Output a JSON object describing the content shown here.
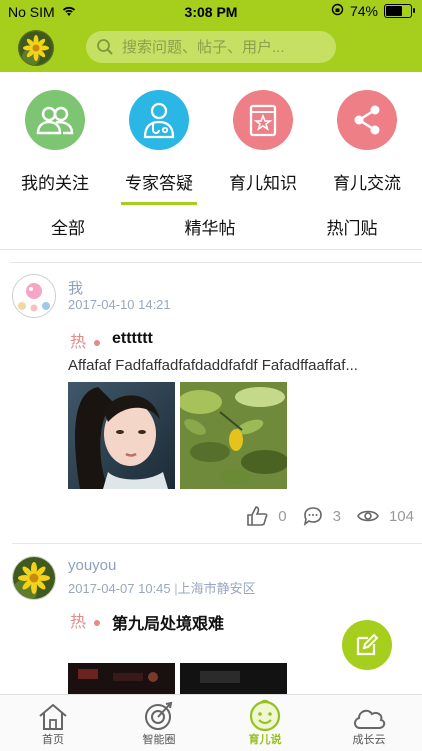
{
  "status_bar": {
    "carrier": "No SIM",
    "time": "3:08 PM",
    "battery": "74%",
    "battery_level": 0.74
  },
  "header": {
    "search_placeholder": "搜索问题、帖子、用户..."
  },
  "categories": [
    {
      "label": "我的关注",
      "icon": "users-icon",
      "color": "#7dc473"
    },
    {
      "label": "专家答疑",
      "icon": "doctor-icon",
      "color": "#2bb7e6"
    },
    {
      "label": "育儿知识",
      "icon": "book-star-icon",
      "color": "#ee7f86"
    },
    {
      "label": "育儿交流",
      "icon": "share-icon",
      "color": "#ee7f86"
    }
  ],
  "active_category": 1,
  "tabs": [
    {
      "label": "全部"
    },
    {
      "label": "精华帖"
    },
    {
      "label": "热门贴"
    }
  ],
  "posts": [
    {
      "username": "我",
      "time": "2017-04-10 14:21",
      "location": "",
      "hot_label": "热",
      "title": "etttttt",
      "excerpt": "Affafaf Fadfaffadfafdaddfafdf Fafadffaaffaf...",
      "likes": "0",
      "comments": "3",
      "views": "104"
    },
    {
      "username": "youyou",
      "time": "2017-04-07 10:45",
      "location": "上海市静安区",
      "hot_label": "热",
      "title": "第九局处境艰难"
    }
  ],
  "bottom_nav": [
    {
      "label": "首页",
      "icon": "home-icon"
    },
    {
      "label": "智能圈",
      "icon": "target-icon"
    },
    {
      "label": "育儿说",
      "icon": "baby-face-icon"
    },
    {
      "label": "成长云",
      "icon": "cloud-icon"
    }
  ],
  "active_nav": 2,
  "colors": {
    "brand": "#a6cf1d",
    "hot": "#e38a8a",
    "meta": "#8ea0bf"
  }
}
